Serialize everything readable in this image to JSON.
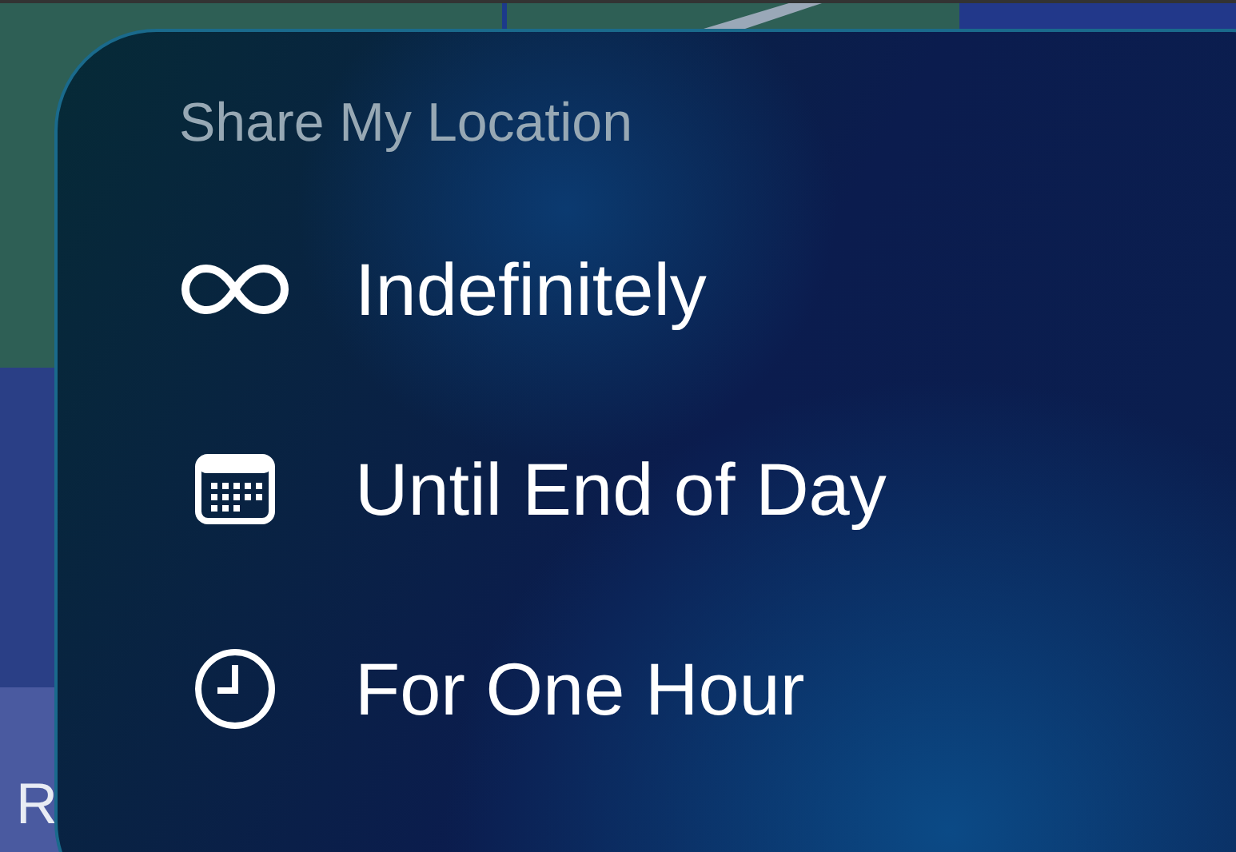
{
  "background": {
    "label": "R"
  },
  "menu": {
    "title": "Share My Location",
    "items": [
      {
        "kind": "infinity",
        "label": "Indefinitely"
      },
      {
        "kind": "calendar",
        "label": "Until End of Day"
      },
      {
        "kind": "clock",
        "label": "For One Hour"
      }
    ]
  }
}
